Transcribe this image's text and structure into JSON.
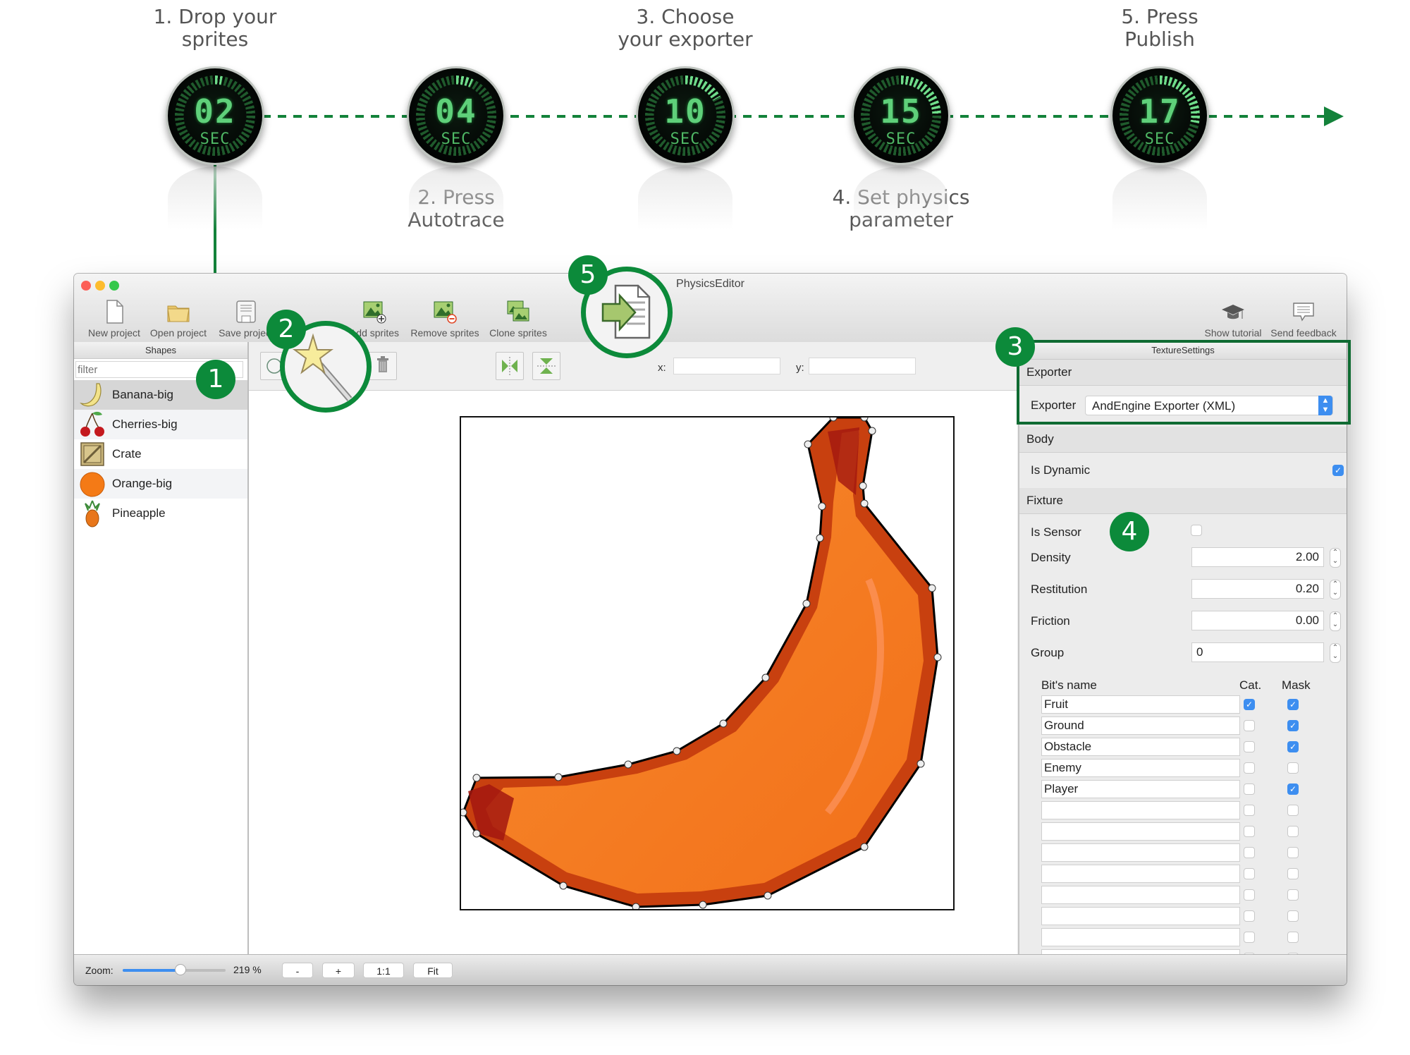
{
  "steps": [
    {
      "label_line1": "1. Drop your",
      "label_line2": "sprites",
      "timer": "02",
      "unit": "SEC",
      "lit_fraction": 0.03
    },
    {
      "label_line1": "2. Press",
      "label_line2": "Autotrace",
      "timer": "04",
      "unit": "SEC",
      "lit_fraction": 0.07
    },
    {
      "label_line1": "3. Choose",
      "label_line2": "your exporter",
      "timer": "10",
      "unit": "SEC",
      "lit_fraction": 0.17
    },
    {
      "label_line1": "4. Set physics",
      "label_line2": "parameter",
      "timer": "15",
      "unit": "SEC",
      "lit_fraction": 0.25
    },
    {
      "label_line1": "5. Press",
      "label_line2": "Publish",
      "timer": "17",
      "unit": "SEC",
      "lit_fraction": 0.28
    }
  ],
  "callouts": [
    "1",
    "2",
    "3",
    "4",
    "5"
  ],
  "colors": {
    "accent_green": "#0c8a3a",
    "checkbox_blue": "#3d8ef0",
    "timer_green": "#5fd07a",
    "banana_orange": "#f77a22"
  },
  "window": {
    "title": "PhysicsEditor",
    "toolbar": [
      {
        "label": "New project",
        "icon": "new-document-icon"
      },
      {
        "label": "Open project",
        "icon": "folder-icon"
      },
      {
        "label": "Save project",
        "icon": "floppy-disk-icon"
      },
      {
        "label": "Add sprites",
        "icon": "add-image-icon"
      },
      {
        "label": "Remove sprites",
        "icon": "remove-image-icon"
      },
      {
        "label": "Clone sprites",
        "icon": "clone-image-icon"
      },
      {
        "label": "Publish",
        "icon": "publish-icon"
      }
    ],
    "toolbar_right": [
      {
        "label": "Show tutorial",
        "icon": "graduation-cap-icon"
      },
      {
        "label": "Send feedback",
        "icon": "speech-bubble-icon"
      }
    ]
  },
  "sidebar": {
    "header": "Shapes",
    "filter_placeholder": "filter",
    "items": [
      {
        "label": "Banana-big",
        "icon": "banana-icon",
        "selected": true
      },
      {
        "label": "Cherries-big",
        "icon": "cherries-icon"
      },
      {
        "label": "Crate",
        "icon": "crate-icon"
      },
      {
        "label": "Orange-big",
        "icon": "orange-icon"
      },
      {
        "label": "Pineapple",
        "icon": "pineapple-icon"
      }
    ]
  },
  "editor": {
    "tools": [
      "circle-tool-icon",
      "magic-wand-icon",
      "trash-icon",
      "flip-horizontal-icon",
      "flip-vertical-icon"
    ],
    "x_label": "x:",
    "y_label": "y:",
    "x_value": "",
    "y_value": "",
    "sprite": "Banana-big"
  },
  "panel": {
    "header": "TextureSettings",
    "exporter_section": "Exporter",
    "exporter_label": "Exporter",
    "exporter_value": "AndEngine Exporter (XML)",
    "body_section": "Body",
    "is_dynamic_label": "Is Dynamic",
    "is_dynamic": true,
    "fixture_section": "Fixture",
    "is_sensor_label": "Is Sensor",
    "is_sensor": false,
    "density_label": "Density",
    "density": "2.00",
    "restitution_label": "Restitution",
    "restitution": "0.20",
    "friction_label": "Friction",
    "friction": "0.00",
    "group_label": "Group",
    "group": "0",
    "bits_header": {
      "name": "Bit's name",
      "cat": "Cat.",
      "mask": "Mask"
    },
    "bits": [
      {
        "name": "Fruit",
        "cat": true,
        "mask": true
      },
      {
        "name": "Ground",
        "cat": false,
        "mask": true
      },
      {
        "name": "Obstacle",
        "cat": false,
        "mask": true
      },
      {
        "name": "Enemy",
        "cat": false,
        "mask": false
      },
      {
        "name": "Player",
        "cat": false,
        "mask": true
      },
      {
        "name": "",
        "cat": false,
        "mask": false
      },
      {
        "name": "",
        "cat": false,
        "mask": false
      },
      {
        "name": "",
        "cat": false,
        "mask": false
      },
      {
        "name": "",
        "cat": false,
        "mask": false
      },
      {
        "name": "",
        "cat": false,
        "mask": false
      },
      {
        "name": "",
        "cat": false,
        "mask": false
      },
      {
        "name": "",
        "cat": false,
        "mask": false
      },
      {
        "name": "",
        "cat": false,
        "mask": false
      }
    ]
  },
  "bottombar": {
    "zoom_label": "Zoom:",
    "zoom_value": "219 %",
    "zoom_slider_fraction": 0.56,
    "buttons": [
      "-",
      "+",
      "1:1",
      "Fit"
    ]
  }
}
